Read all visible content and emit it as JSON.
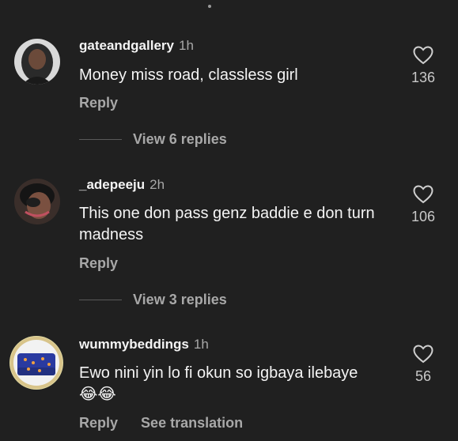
{
  "comments": [
    {
      "username": "gateandgallery",
      "time": "1h",
      "text": "Money miss road, classless girl",
      "likes": "136",
      "reply_label": "Reply",
      "view_replies": "View 6 replies"
    },
    {
      "username": "_adepeeju",
      "time": "2h",
      "text": "This one don pass genz baddie e don turn madness",
      "likes": "106",
      "reply_label": "Reply",
      "view_replies": "View 3 replies"
    },
    {
      "username": "wummybeddings",
      "time": "1h",
      "text": "Ewo nini yin lo fi okun so igbaya ilebaye",
      "emoji": "😂😂",
      "likes": "56",
      "reply_label": "Reply",
      "translate_label": "See translation"
    }
  ],
  "icons": {
    "like": "heart-outline-icon"
  },
  "colors": {
    "background": "#202020",
    "primary_text": "#f4f4f4",
    "secondary_text": "#a8a8a8"
  }
}
